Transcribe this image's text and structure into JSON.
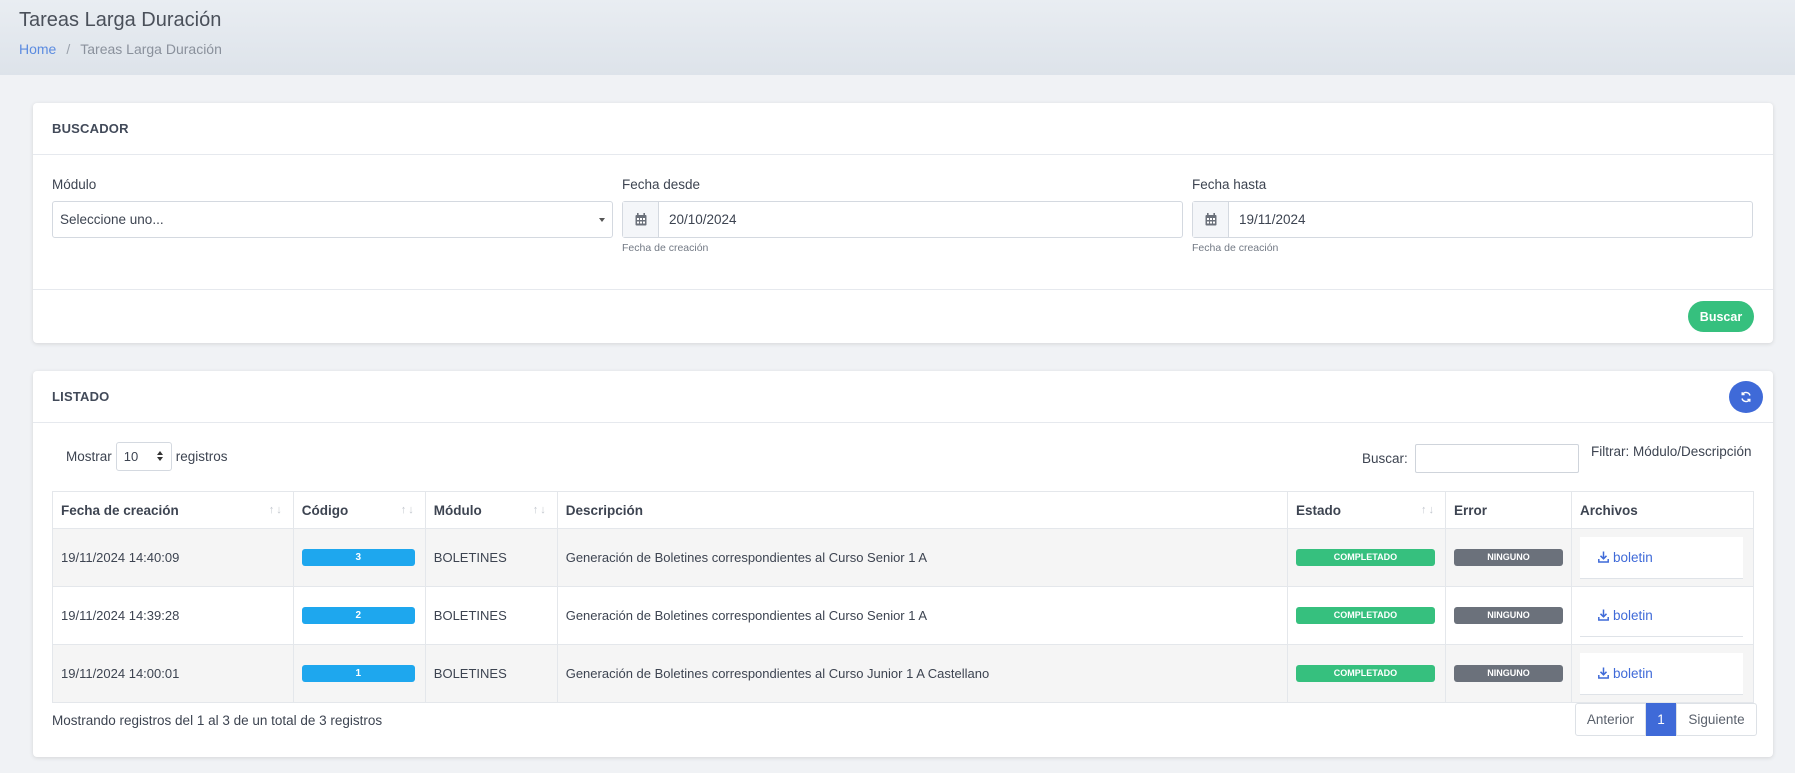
{
  "header": {
    "title": "Tareas Larga Duración",
    "breadcrumb": {
      "home": "Home",
      "separator": "/",
      "current": "Tareas Larga Duración"
    }
  },
  "buscador": {
    "title": "BUSCADOR",
    "modulo": {
      "label": "Módulo",
      "value": "Seleccione uno..."
    },
    "fecha_desde": {
      "label": "Fecha desde",
      "value": "20/10/2024",
      "help": "Fecha de creación"
    },
    "fecha_hasta": {
      "label": "Fecha hasta",
      "value": "19/11/2024",
      "help": "Fecha de creación"
    },
    "search_button": "Buscar"
  },
  "listado": {
    "title": "LISTADO",
    "show_prefix": "Mostrar",
    "page_length": "10",
    "show_suffix": "registros",
    "search_label": "Buscar:",
    "filter_note": "Filtrar: Módulo/Descripción",
    "columns": [
      "Fecha de creación",
      "Código",
      "Módulo",
      "Descripción",
      "Estado",
      "Error",
      "Archivos"
    ],
    "rows": [
      {
        "fecha": "19/11/2024 14:40:09",
        "codigo": "3",
        "modulo": "BOLETINES",
        "descripcion": "Generación de Boletines correspondientes al Curso Senior 1 A",
        "estado": "COMPLETADO",
        "error": "NINGUNO",
        "archivo": "boletin"
      },
      {
        "fecha": "19/11/2024 14:39:28",
        "codigo": "2",
        "modulo": "BOLETINES",
        "descripcion": "Generación de Boletines correspondientes al Curso Senior 1 A",
        "estado": "COMPLETADO",
        "error": "NINGUNO",
        "archivo": "boletin"
      },
      {
        "fecha": "19/11/2024 14:00:01",
        "codigo": "1",
        "modulo": "BOLETINES",
        "descripcion": "Generación de Boletines correspondientes al Curso Junior 1 A Castellano",
        "estado": "COMPLETADO",
        "error": "NINGUNO",
        "archivo": "boletin"
      }
    ],
    "info": "Mostrando registros del 1 al 3 de un total de 3 registros",
    "pagination": {
      "prev": "Anterior",
      "current": "1",
      "next": "Siguiente"
    }
  },
  "colors": {
    "primary": "#3f6ad8",
    "success": "#36c07e",
    "info": "#1ea7ee",
    "secondary": "#6b717b",
    "link": "#5b8be0"
  },
  "icons": {
    "calendar": "calendar-icon",
    "refresh": "refresh-icon",
    "download": "download-icon"
  }
}
